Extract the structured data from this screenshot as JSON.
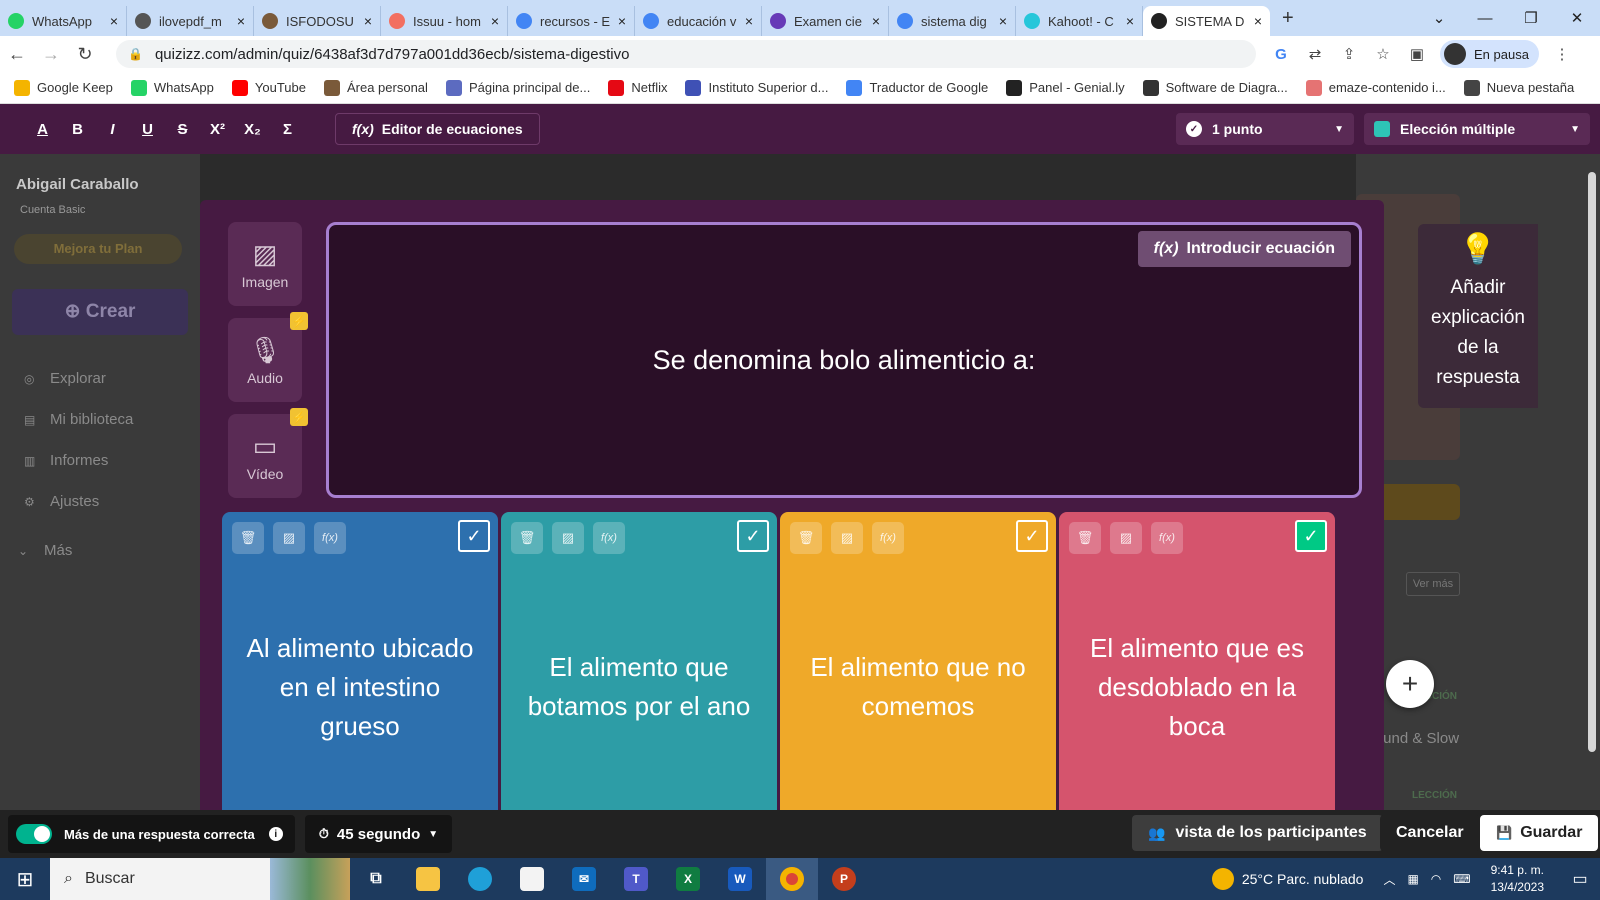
{
  "browser": {
    "tabs": [
      {
        "label": "WhatsApp",
        "icon": "whatsapp-icon",
        "color": "#25d366"
      },
      {
        "label": "ilovepdf_m",
        "icon": "globe-icon",
        "color": "#555555"
      },
      {
        "label": "ISFODOSU",
        "icon": "crest-icon",
        "color": "#7a5a3a"
      },
      {
        "label": "Issuu - hom",
        "icon": "issuu-icon",
        "color": "#f26f61"
      },
      {
        "label": "recursos - E",
        "icon": "google-icon",
        "color": "#4285f4"
      },
      {
        "label": "educación v",
        "icon": "google-icon",
        "color": "#4285f4"
      },
      {
        "label": "Examen cie",
        "icon": "forms-icon",
        "color": "#673ab7"
      },
      {
        "label": "sistema dig",
        "icon": "google-icon",
        "color": "#4285f4"
      },
      {
        "label": "Kahoot! - C",
        "icon": "kahoot-icon",
        "color": "#26c6da"
      },
      {
        "label": "SISTEMA D",
        "icon": "quizizz-icon",
        "color": "#222222",
        "active": true
      }
    ],
    "url": "quizizz.com/admin/quiz/6438af3d7d797a001dd36ecb/sistema-digestivo",
    "profile_label": "En pausa",
    "bookmarks": [
      {
        "label": "Google Keep",
        "color": "#f4b400"
      },
      {
        "label": "WhatsApp",
        "color": "#25d366"
      },
      {
        "label": "YouTube",
        "color": "#ff0000"
      },
      {
        "label": "Área personal",
        "color": "#7a5a3a"
      },
      {
        "label": "Página principal de...",
        "color": "#5c6bc0"
      },
      {
        "label": "Netflix",
        "color": "#e50914"
      },
      {
        "label": "Instituto Superior d...",
        "color": "#3f51b5"
      },
      {
        "label": "Traductor de Google",
        "color": "#4285f4"
      },
      {
        "label": "Panel - Genial.ly",
        "color": "#222222"
      },
      {
        "label": "Software de Diagra...",
        "color": "#333333"
      },
      {
        "label": "emaze-contenido i...",
        "color": "#e57373"
      },
      {
        "label": "Nueva pestaña",
        "color": "#444444"
      }
    ]
  },
  "toolbar": {
    "equation_editor": "Editor de ecuaciones",
    "points": "1 punto",
    "question_type": "Elección múltiple"
  },
  "sidebar": {
    "user": "Abigail Caraballo",
    "account": "Cuenta Basic",
    "upgrade": "Mejora tu Plan",
    "create": "Crear",
    "items": [
      "Explorar",
      "Mi biblioteca",
      "Informes",
      "Ajustes",
      "Más"
    ]
  },
  "background_right": {
    "see_more": "Ver más",
    "item1": "Round & Slow",
    "tag1": "LECCIÓN",
    "tag2": "LECCIÓN"
  },
  "media": {
    "image": "Imagen",
    "audio": "Audio",
    "video": "Vídeo"
  },
  "question": {
    "insert_equation": "Introducir ecuación",
    "text": "Se denomina bolo alimenticio a:"
  },
  "answers": [
    {
      "text": "Al alimento ubicado en el intestino grueso",
      "color": "#2d70ae",
      "correct": false
    },
    {
      "text": "El alimento que botamos por el ano",
      "color": "#2d9da6",
      "correct": false
    },
    {
      "text": "El alimento que no comemos",
      "color": "#efa929",
      "correct": false
    },
    {
      "text": "El alimento que es desdoblado en la boca",
      "color": "#d5546d",
      "correct": true
    }
  ],
  "explanation": "Añadir explicación de la respuesta",
  "bottom": {
    "multi_correct": "Más de una respuesta correcta",
    "timer": "45 segundo",
    "participants_view": "vista de los participantes",
    "cancel": "Cancelar",
    "save": "Guardar"
  },
  "taskbar": {
    "search": "Buscar",
    "weather": "25°C Parc. nublado",
    "time": "9:41 p. m.",
    "date": "13/4/2023"
  }
}
